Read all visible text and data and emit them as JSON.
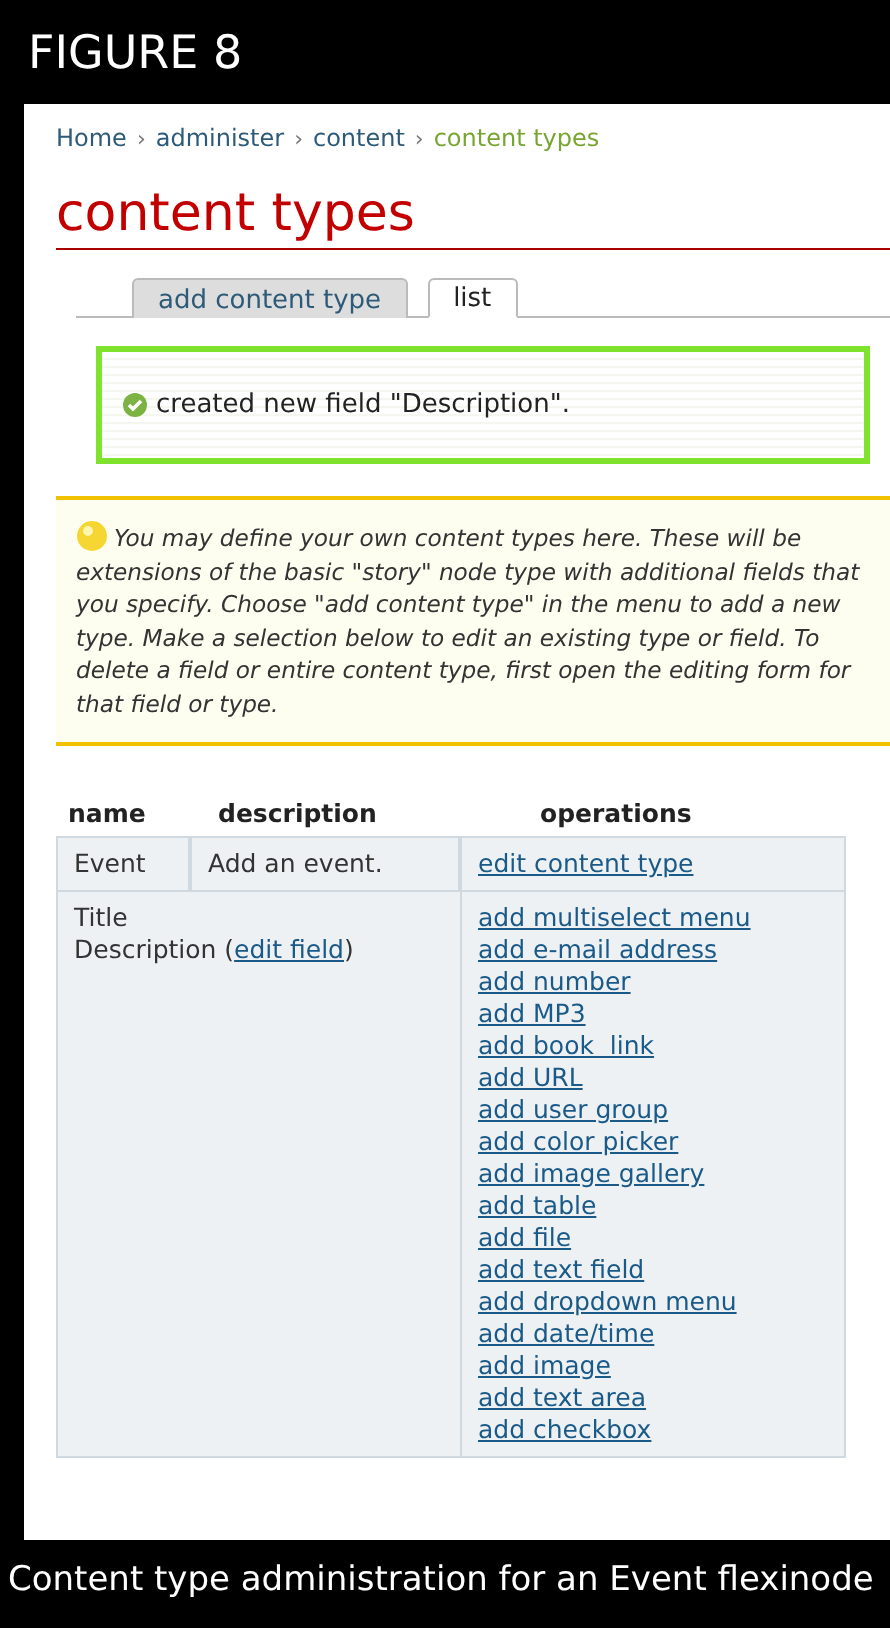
{
  "figure_label": "FIGURE 8",
  "breadcrumb": {
    "separator": "›",
    "items": [
      {
        "label": "Home",
        "current": false
      },
      {
        "label": "administer",
        "current": false
      },
      {
        "label": "content",
        "current": false
      },
      {
        "label": "content types",
        "current": true
      }
    ]
  },
  "page_title": "content types",
  "tabs": [
    {
      "label": "add content type",
      "selected": false
    },
    {
      "label": "list",
      "selected": true
    }
  ],
  "status_message": {
    "kind": "success",
    "text": "created new field \"Description\"."
  },
  "help": {
    "kind": "info",
    "text": "You may define your own content types here. These will be extensions of the basic \"story\" node type with additional fields that you specify. Choose \"add content type\" in the menu to add a new type. Make a selection below to edit an existing type or field. To delete a field or entire content type, first open the editing form for that field or type."
  },
  "table": {
    "columns": [
      "name",
      "description",
      "operations"
    ],
    "type_row": {
      "name": "Event",
      "description": "Add an event.",
      "operations": [
        "edit content type"
      ]
    },
    "fields_row": {
      "fields": [
        {
          "text": "Title"
        },
        {
          "text": "Description (",
          "link": "edit field",
          "after": ")"
        }
      ],
      "operations": [
        "add multiselect menu",
        "add e-mail address",
        "add number",
        "add MP3",
        "add book  link",
        "add URL",
        "add user group",
        "add color picker",
        "add image gallery",
        "add table",
        "add file",
        "add text field",
        "add dropdown menu",
        "add date/time",
        "add image",
        "add text area",
        "add checkbox"
      ]
    }
  },
  "caption": "Content type administration for an Event flexinode"
}
